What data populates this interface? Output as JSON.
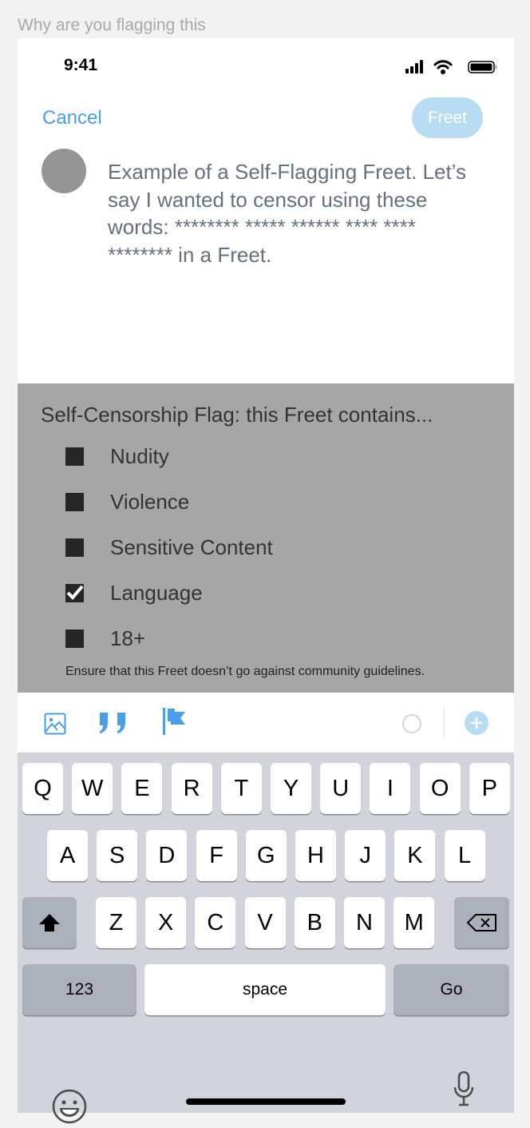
{
  "caption": "Why are you flagging this",
  "status": {
    "time": "9:41"
  },
  "header": {
    "cancel": "Cancel",
    "freet": "Freet"
  },
  "compose": {
    "text": "Example of a Self-Flagging Freet. Let’s say I wanted to censor using these words: ******** ***** ****** **** **** ******** in a Freet."
  },
  "flag": {
    "title": "Self-Censorship Flag: this Freet contains...",
    "options": [
      {
        "label": "Nudity",
        "checked": false
      },
      {
        "label": "Violence",
        "checked": false
      },
      {
        "label": "Sensitive Content",
        "checked": false
      },
      {
        "label": "Language",
        "checked": true
      },
      {
        "label": "18+",
        "checked": false
      }
    ],
    "note": "Ensure that this Freet doesn’t go against community guidelines."
  },
  "keyboard": {
    "rows": [
      [
        "Q",
        "W",
        "E",
        "R",
        "T",
        "Y",
        "U",
        "I",
        "O",
        "P"
      ],
      [
        "A",
        "S",
        "D",
        "F",
        "G",
        "H",
        "J",
        "K",
        "L"
      ],
      [
        "Z",
        "X",
        "C",
        "V",
        "B",
        "N",
        "M"
      ]
    ],
    "numbers": "123",
    "space": "space",
    "go": "Go"
  },
  "colors": {
    "accent": "#4a9fe8",
    "accent_light": "#b9dcf5"
  }
}
